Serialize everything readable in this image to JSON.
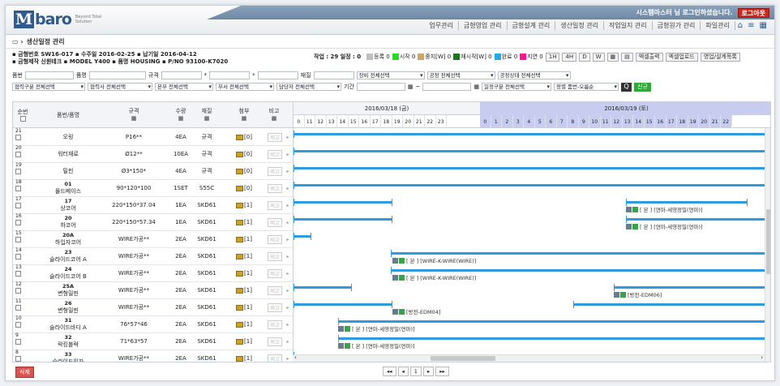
{
  "header": {
    "logo_m": "M",
    "logo_rest": "baro",
    "logo_tagline": "Beyond Total Solution",
    "greeting": "시스템마스터 님 로그인하셨습니다.",
    "logout": "로그아웃",
    "menu": [
      "업무관리",
      "금형영업 관리",
      "금형설계 관리",
      "생산일정 관리",
      "작업일지 관리",
      "금형원가 관리",
      "파일관리"
    ]
  },
  "page_title": "생산일정 관리",
  "info": {
    "line1": "▪ 금형번호 SW16-017   ▪ 수주일 2016-02-25   ▪ 납기일 2016-04-12",
    "line2": "▪ 금형제작 신원테크   ▪ MODEL Y400   ▪ 품명 HOUSING   ▪ P/NO 93100-K7020",
    "work": "작업 : 29  일정 : 0",
    "legend": [
      {
        "label": "등록 0",
        "color": "#bfbfbf"
      },
      {
        "label": "시작 0",
        "color": "#2bd92b"
      },
      {
        "label": "중지[W] 0",
        "color": "#c9a66b"
      },
      {
        "label": "재시작[W] 0",
        "color": "#1a7a1a"
      },
      {
        "label": "완료 0",
        "color": "#27a8e6"
      },
      {
        "label": "지연 0",
        "color": "#ff1493"
      }
    ],
    "view_buttons": [
      "1H",
      "4H",
      "D",
      "W",
      "▦",
      "▤",
      "엑셀출력",
      "엑셀업로드",
      "영업/설계목록"
    ]
  },
  "filters": {
    "row1": [
      "품번",
      "품명",
      "규격",
      "재질",
      "장비 전체선택",
      "공정 전체선택",
      "공정상태 전체선택"
    ],
    "row2": [
      "협력구분 전체선택",
      "협력사 전체선택",
      "본부 전체선택",
      "부서 전체선택",
      "담당자 전체선택",
      "기간",
      "일정구분 전체선택",
      "정렬 품번-오름순"
    ],
    "search": "Q",
    "new": "신규"
  },
  "table": {
    "headers": {
      "seq": "순번",
      "name": "품번/품명",
      "spec": "규격",
      "qty": "수량",
      "mat": "재질",
      "att": "첨부",
      "rmk": "비고"
    },
    "rows": [
      {
        "seq": "21",
        "code": "",
        "name": "오링",
        "spec": "P16**",
        "qty": "4EA",
        "mat": "규격",
        "att": "[0]"
      },
      {
        "seq": "20",
        "code": "",
        "name": "워터재로",
        "spec": "Ø12**",
        "qty": "10EA",
        "mat": "규격",
        "att": "[0]"
      },
      {
        "seq": "19",
        "code": "",
        "name": "밀핀",
        "spec": "Ø3*150*",
        "qty": "4EA",
        "mat": "규격",
        "att": "[0]"
      },
      {
        "seq": "18",
        "code": "01",
        "name": "몰드베이스",
        "spec": "90*120*100",
        "qty": "1SET",
        "mat": "S55C",
        "att": "[0]"
      },
      {
        "seq": "17",
        "code": "17",
        "name": "상코어",
        "spec": "220*150*37.04",
        "qty": "1EA",
        "mat": "SKD61",
        "att": "[1]"
      },
      {
        "seq": "16",
        "code": "20",
        "name": "하코어",
        "spec": "220*150*57.34",
        "qty": "1EA",
        "mat": "SKD61",
        "att": "[1]"
      },
      {
        "seq": "15",
        "code": "20A",
        "name": "하입자코어",
        "spec": "WIRE가공**",
        "qty": "2EA",
        "mat": "SKD61",
        "att": "[1]"
      },
      {
        "seq": "14",
        "code": "23",
        "name": "슬라이드코어 A",
        "spec": "WIRE가공**",
        "qty": "2EA",
        "mat": "SKD61",
        "att": "[1]"
      },
      {
        "seq": "13",
        "code": "24",
        "name": "슬라이드코어 B",
        "spec": "WIRE가공**",
        "qty": "2EA",
        "mat": "SKD61",
        "att": "[1]"
      },
      {
        "seq": "12",
        "code": "25A",
        "name": "변형밀핀",
        "spec": "WIRE가공**",
        "qty": "2EA",
        "mat": "SKD61",
        "att": "[1]"
      },
      {
        "seq": "11",
        "code": "26",
        "name": "변형밀핀",
        "spec": "WIRE가공**",
        "qty": "2EA",
        "mat": "SKD61",
        "att": "[1]"
      },
      {
        "seq": "10",
        "code": "31",
        "name": "슬라이드바디 A",
        "spec": "76*57*46",
        "qty": "2EA",
        "mat": "SKD61",
        "att": "[1]"
      },
      {
        "seq": "9",
        "code": "32",
        "name": "락킹블럭",
        "spec": "71*63*57",
        "qty": "2EA",
        "mat": "SKD61",
        "att": "[1]"
      },
      {
        "seq": "8",
        "code": "33",
        "name": "슬라이드인자",
        "spec": "WIRE가공**",
        "qty": "2EA",
        "mat": "SKD61",
        "att": "[1]"
      }
    ],
    "remark_label": "비고"
  },
  "gantt": {
    "day1": "2016/03/18 (금)",
    "day2": "2016/03/19 (토)",
    "hours1": [
      "0",
      "11",
      "12",
      "13",
      "14",
      "15",
      "16",
      "17",
      "18",
      "19",
      "20",
      "21",
      "22",
      "23"
    ],
    "hours2": [
      "0",
      "1",
      "2",
      "3",
      "4",
      "5",
      "6",
      "7",
      "8",
      "9",
      "10",
      "11",
      "12",
      "13",
      "14",
      "15",
      "16",
      "17",
      "18",
      "19",
      "20",
      "21",
      "22"
    ],
    "notes": [
      {
        "row": 4,
        "text": "[ 본 ] [연마-세영정밀(연마)]"
      },
      {
        "row": 5,
        "text": "[ 본 ] [연마-세영정밀(연마)]"
      },
      {
        "row": 7,
        "text": "[ 본 ] [WIRE-K-WIRE(WIRE)]"
      },
      {
        "row": 8,
        "text": "[ 본 ] [WIRE-K-WIRE(WIRE)]"
      },
      {
        "row": 9,
        "text": "[방전-EDM06]"
      },
      {
        "row": 10,
        "text": "[방전-EDM04]"
      },
      {
        "row": 11,
        "text": "[ 본 ] [연마-세영정밀(연마)]"
      },
      {
        "row": 12,
        "text": "[ 본 ] [연마-세영정밀(연마)]"
      }
    ]
  },
  "footer": {
    "delete": "삭제",
    "pager": [
      "◂◂",
      "◂",
      "1",
      "▸",
      "▸▸"
    ]
  }
}
